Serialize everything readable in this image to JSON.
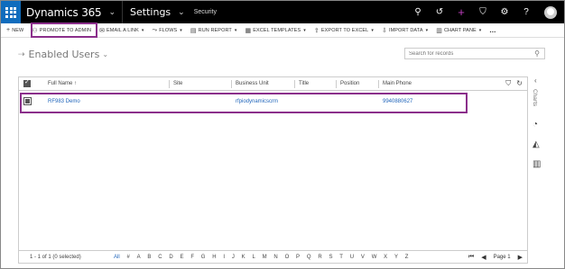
{
  "topbar": {
    "app_name": "Dynamics 365",
    "area_name": "Settings",
    "sub_area": "Security",
    "icons": [
      "search-icon",
      "history-icon",
      "plus-icon",
      "filter-icon",
      "gear-icon",
      "help-icon",
      "avatar"
    ]
  },
  "commands": [
    {
      "label": "NEW",
      "icon": "+",
      "name": "new-button",
      "dropdown": false
    },
    {
      "label": "PROMOTE TO ADMIN",
      "icon": "⚇",
      "name": "promote-to-admin-button",
      "dropdown": false
    },
    {
      "label": "EMAIL A LINK",
      "icon": "✉",
      "name": "email-a-link-button",
      "dropdown": true
    },
    {
      "label": "FLOWS",
      "icon": "⤳",
      "name": "flows-button",
      "dropdown": true
    },
    {
      "label": "RUN REPORT",
      "icon": "▤",
      "name": "run-report-button",
      "dropdown": true
    },
    {
      "label": "EXCEL TEMPLATES",
      "icon": "▦",
      "name": "excel-templates-button",
      "dropdown": true
    },
    {
      "label": "EXPORT TO EXCEL",
      "icon": "⇪",
      "name": "export-to-excel-button",
      "dropdown": true
    },
    {
      "label": "IMPORT DATA",
      "icon": "⇩",
      "name": "import-data-button",
      "dropdown": true
    },
    {
      "label": "CHART PANE",
      "icon": "▥",
      "name": "chart-pane-button",
      "dropdown": true
    },
    {
      "label": "...",
      "icon": "",
      "name": "more-commands-button",
      "dropdown": false
    }
  ],
  "view": {
    "title": "Enabled Users",
    "search_placeholder": "Search for records"
  },
  "grid": {
    "columns": [
      "Full Name ↑",
      "Site",
      "Business Unit",
      "Title",
      "Position",
      "Main Phone"
    ],
    "rows": [
      {
        "full_name": "RF983 Demo",
        "site": "",
        "business_unit": "rfpiodynamicscrm",
        "title": "",
        "position": "",
        "main_phone": "9940880627",
        "selected": true
      }
    ],
    "record_count": "1 - 1 of 1 (0 selected)",
    "alphabet": [
      "All",
      "#",
      "A",
      "B",
      "C",
      "D",
      "E",
      "F",
      "G",
      "H",
      "I",
      "J",
      "K",
      "L",
      "M",
      "N",
      "O",
      "P",
      "Q",
      "R",
      "S",
      "T",
      "U",
      "V",
      "W",
      "X",
      "Y",
      "Z"
    ],
    "page_label": "Page 1"
  },
  "side_pane": {
    "label": "Charts"
  },
  "highlight_color": "#8b2f8b"
}
